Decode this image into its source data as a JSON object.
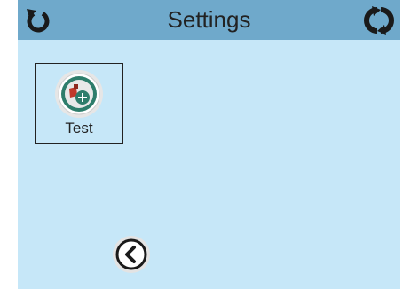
{
  "header": {
    "title": "Settings",
    "left_icon": "restart-icon",
    "right_icon": "refresh-icon"
  },
  "tiles": [
    {
      "label": "Test",
      "icon": "test-spa-icon"
    }
  ],
  "footer": {
    "back_icon": "chevron-left-icon"
  },
  "colors": {
    "background": "#c6e7f8",
    "header": "#6fa9cb",
    "icon_ring": "#2e7d6b",
    "icon_accent": "#c0392b"
  }
}
